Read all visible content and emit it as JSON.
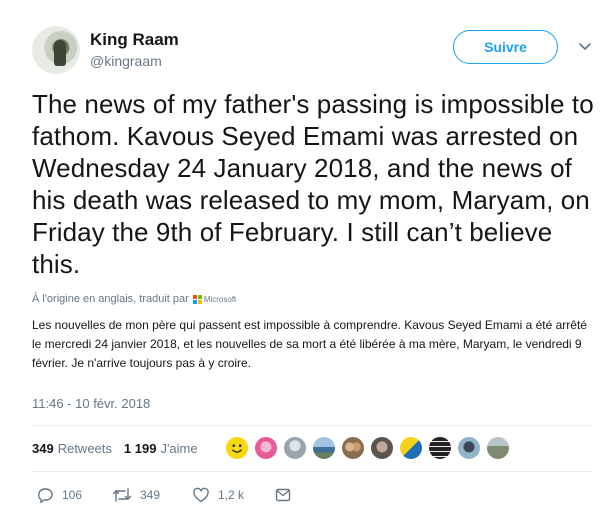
{
  "profile": {
    "display_name": "King Raam",
    "handle": "@kingraam",
    "follow_label": "Suivre"
  },
  "tweet": {
    "text": "The news of my father's passing is impossible to fathom. Kavous Seyed Emami was arrested on Wednesday 24 January 2018, and the news of his death was released to my mom, Maryam, on Friday the 9th of February. I still can’t believe this.",
    "translated_by_label": "À l'origine en anglais, traduit par",
    "translator_name": "Microsoft",
    "translation_text": "Les nouvelles de mon père qui passent est impossible à comprendre. Kavous Seyed Emami a été arrêté le mercredi 24 janvier 2018, et les nouvelles de sa mort a été libérée à ma mère, Maryam, le vendredi 9 février. Je n'arrive toujours pas à y croire.",
    "timestamp": "11:46 - 10 févr. 2018"
  },
  "stats": {
    "retweets_count": "349",
    "retweets_label": "Retweets",
    "likes_count": "1 199",
    "likes_label": "J'aime"
  },
  "likers": [
    {
      "icon": "smiley-avatar",
      "color": "#f5d90a"
    },
    {
      "icon": "pink-character-avatar",
      "color": "#e75a9a"
    },
    {
      "icon": "person-avatar",
      "color": "#9aa4ad"
    },
    {
      "icon": "landscape-avatar",
      "color": "#5b8db8"
    },
    {
      "icon": "group-avatar",
      "color": "#8a6d4f"
    },
    {
      "icon": "portrait-avatar",
      "color": "#5a5450"
    },
    {
      "icon": "flag-avatar",
      "color": "#1f6fb5"
    },
    {
      "icon": "text-avatar",
      "color": "#222222"
    },
    {
      "icon": "sky-avatar",
      "color": "#8fb3c9"
    },
    {
      "icon": "outdoor-avatar",
      "color": "#7f8a70"
    }
  ],
  "actions": {
    "reply_count": "106",
    "retweet_count": "349",
    "like_count": "1,2 k"
  },
  "colors": {
    "accent": "#1da1f2",
    "secondary_text": "#657786",
    "primary_text": "#14171a"
  }
}
